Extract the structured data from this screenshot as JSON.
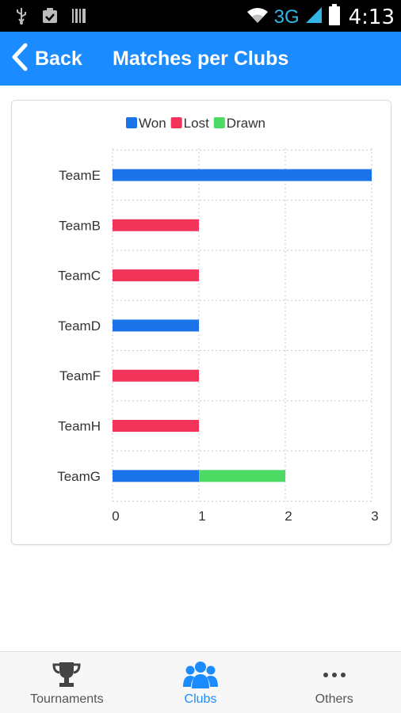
{
  "status_bar": {
    "network": "3G",
    "time": "4:13"
  },
  "header": {
    "back_label": "Back",
    "title": "Matches per Clubs"
  },
  "chart_data": {
    "type": "bar",
    "orientation": "horizontal",
    "stacked": true,
    "categories": [
      "TeamE",
      "TeamB",
      "TeamC",
      "TeamD",
      "TeamF",
      "TeamH",
      "TeamG"
    ],
    "series": [
      {
        "name": "Won",
        "color": "#1a73e8",
        "values": [
          3,
          0,
          0,
          1,
          0,
          0,
          1
        ]
      },
      {
        "name": "Lost",
        "color": "#f2335a",
        "values": [
          0,
          1,
          1,
          0,
          1,
          1,
          0
        ]
      },
      {
        "name": "Drawn",
        "color": "#4cd964",
        "values": [
          0,
          0,
          0,
          0,
          0,
          0,
          1
        ]
      }
    ],
    "x_ticks": [
      "0",
      "1",
      "2",
      "3"
    ],
    "xlim": [
      0,
      3
    ],
    "grid": true,
    "legend_position": "top"
  },
  "bottom_nav": {
    "items": [
      {
        "label": "Tournaments",
        "icon": "trophy-icon",
        "active": false
      },
      {
        "label": "Clubs",
        "icon": "group-icon",
        "active": true
      },
      {
        "label": "Others",
        "icon": "more-icon",
        "active": false
      }
    ],
    "active_color": "#1a8cff"
  }
}
